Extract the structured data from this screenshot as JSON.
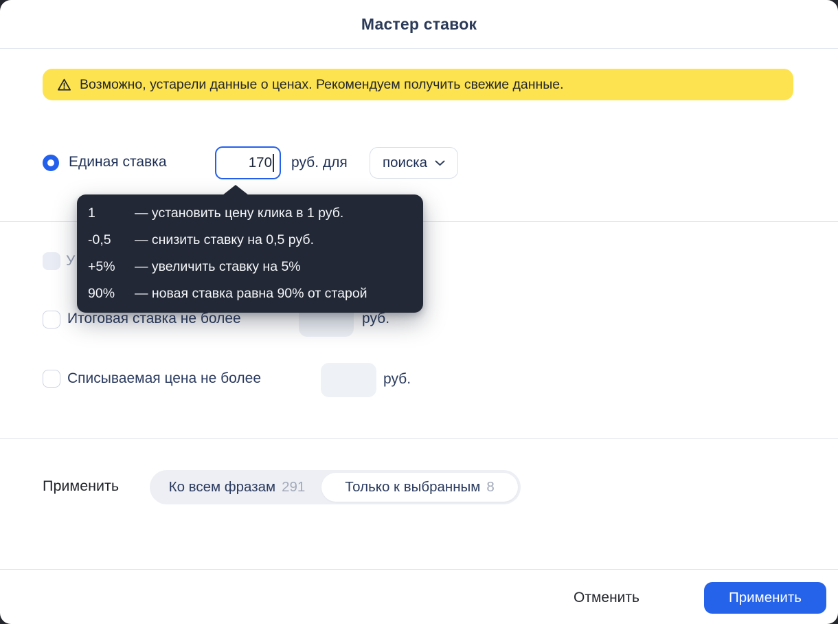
{
  "header": {
    "title": "Мастер ставок"
  },
  "warning": {
    "icon": "warning-triangle-icon",
    "text": "Возможно, устарели данные о ценах. Рекомендуем получить свежие данные.",
    "background_color": "#fde34f"
  },
  "bid_row": {
    "radio_label": "Единая ставка",
    "radio_selected": true,
    "amount_value": "170",
    "amount_suffix": "руб. для",
    "target_select": {
      "value": "поиска",
      "icon": "chevron-down-icon"
    }
  },
  "hint_tooltip": {
    "background_color": "#222835",
    "rows": [
      {
        "term": "1",
        "description": "— установить цену клика в 1 руб."
      },
      {
        "term": "-0,5",
        "description": "— снизить ставку на 0,5 руб."
      },
      {
        "term": "+5%",
        "description": "— увеличить ставку на 5%"
      },
      {
        "term": "90%",
        "description": "— новая ставка равна 90% от старой"
      }
    ]
  },
  "options": {
    "row1": {
      "visible_label_fragment": "У",
      "checked": false,
      "disabled": true
    },
    "row2": {
      "label": "Итоговая ставка не более",
      "value": "",
      "unit": "руб.",
      "checked": false
    },
    "row3": {
      "label": "Списываемая цена не более",
      "value": "",
      "unit": "руб.",
      "checked": false
    }
  },
  "apply_scope": {
    "label": "Применить",
    "segments": [
      {
        "label": "Ко всем фразам",
        "count": "291",
        "selected": false
      },
      {
        "label": "Только к выбранным",
        "count": "8",
        "selected": true
      }
    ]
  },
  "footer": {
    "cancel_label": "Отменить",
    "apply_label": "Применить",
    "accent_color": "#2563eb"
  }
}
